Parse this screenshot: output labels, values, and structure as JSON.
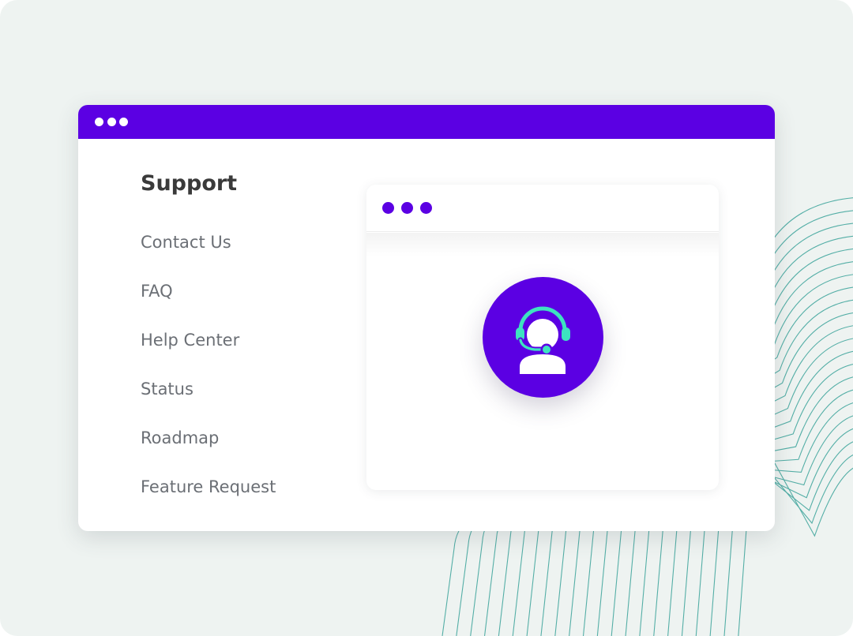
{
  "menu": {
    "title": "Support",
    "items": [
      {
        "label": "Contact Us"
      },
      {
        "label": "FAQ"
      },
      {
        "label": "Help Center"
      },
      {
        "label": "Status"
      },
      {
        "label": "Roadmap"
      },
      {
        "label": "Feature Request"
      }
    ]
  },
  "illustration": {
    "icon": "support-agent-headset-icon"
  },
  "colors": {
    "background": "#eef3f1",
    "brand_purple": "#5b00e3",
    "headset_accent": "#3de3c0",
    "contour_lines": "#3aa39a",
    "menu_title": "#3a3a3a",
    "menu_item": "#6b6f75"
  }
}
